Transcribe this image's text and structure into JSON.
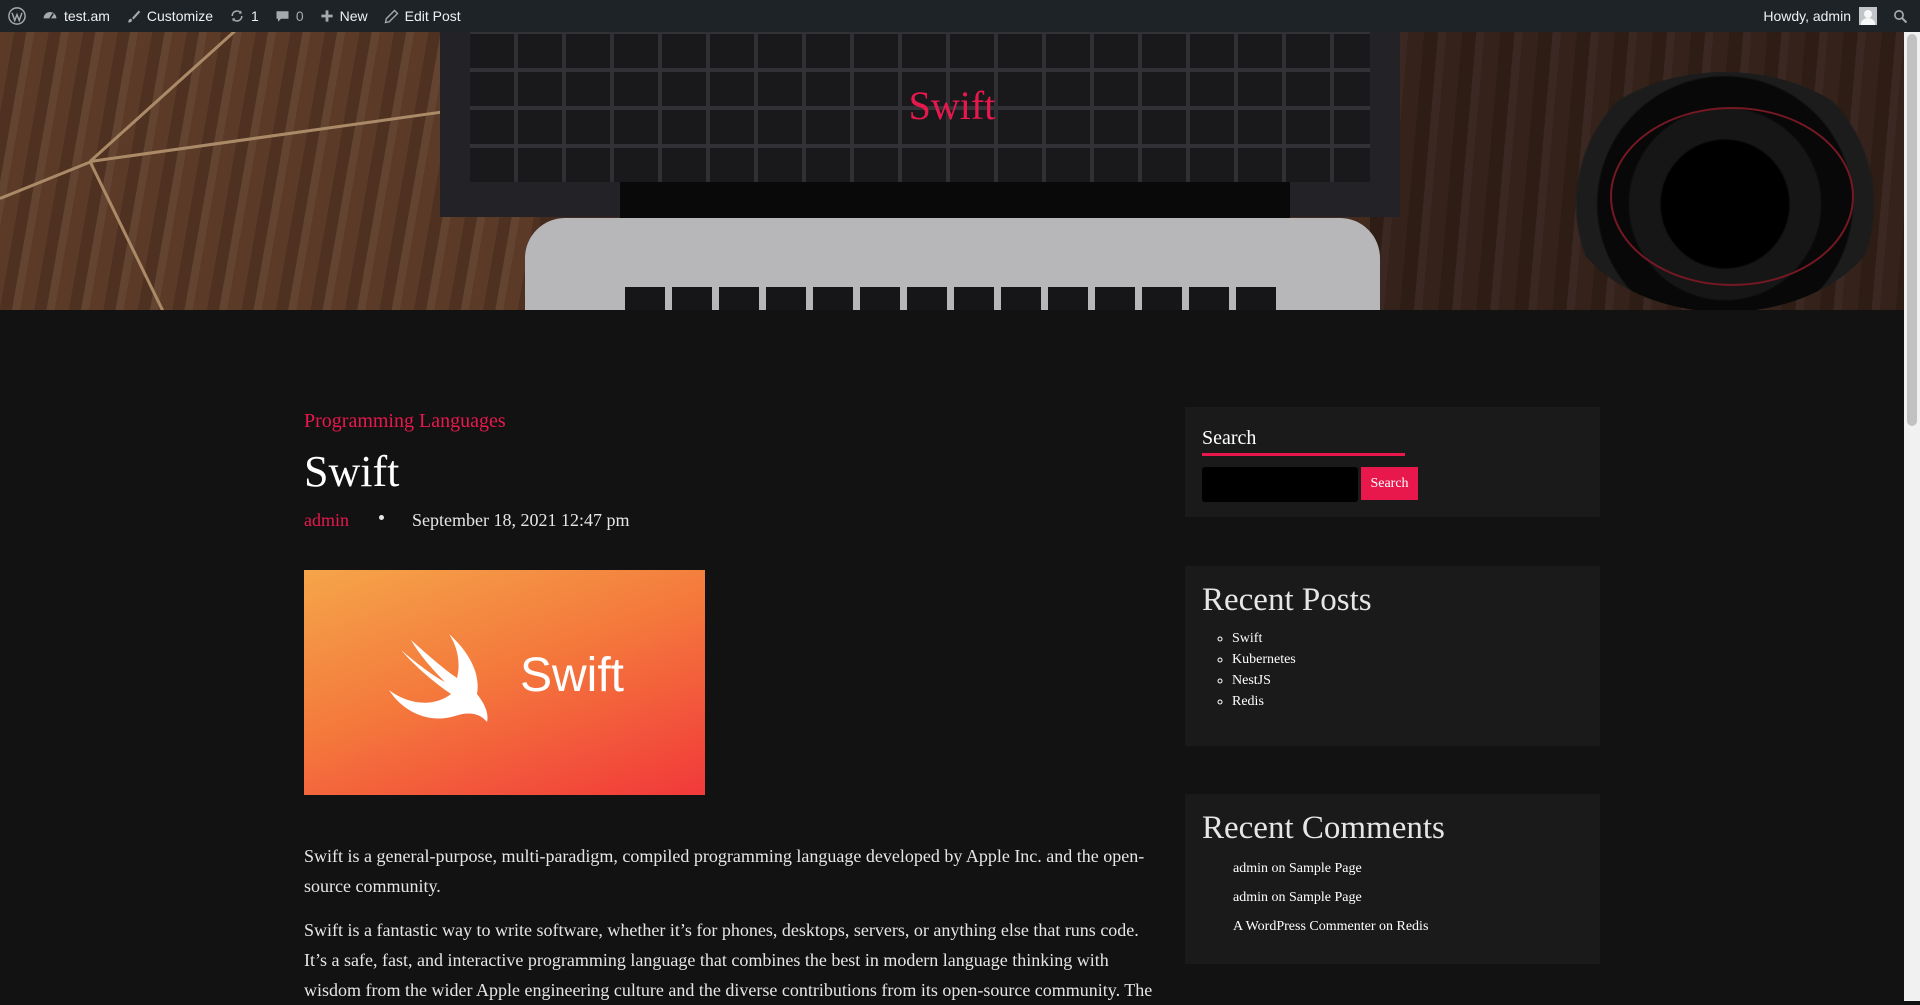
{
  "admin_bar": {
    "site_name": "test.am",
    "customize": "Customize",
    "updates_count": "1",
    "comments_count": "0",
    "new": "New",
    "edit_post": "Edit Post",
    "greeting": "Howdy, admin"
  },
  "header": {
    "site_title": "Swift"
  },
  "post": {
    "category": "Programming Languages",
    "title": "Swift",
    "author": "admin",
    "date": "September 18, 2021 12:47 pm",
    "featured_image_text": "Swift",
    "paragraphs": [
      "Swift is a general-purpose, multi-paradigm, compiled programming language developed by Apple Inc. and the open-source community.",
      "Swift is a fantastic way to write software, whether it’s for phones, desktops, servers, or anything else that runs code. It’s a safe, fast, and interactive programming language that combines the best in modern language thinking with wisdom from the wider Apple engineering culture and the diverse contributions from its open-source community. The"
    ]
  },
  "sidebar": {
    "search": {
      "title": "Search",
      "button": "Search",
      "value": ""
    },
    "recent_posts": {
      "title": "Recent Posts",
      "items": [
        "Swift",
        "Kubernetes",
        "NestJS",
        "Redis"
      ]
    },
    "recent_comments": {
      "title": "Recent Comments",
      "items": [
        {
          "author": "admin",
          "on": "on",
          "post": "Sample Page"
        },
        {
          "author": "admin",
          "on": "on",
          "post": "Sample Page"
        },
        {
          "author": "A WordPress Commenter",
          "on": "on",
          "post": "Redis"
        }
      ]
    }
  },
  "colors": {
    "accent": "#e8184d",
    "background": "#121212",
    "widget_bg": "#1a1a1a",
    "admin_bar": "#1d2327"
  }
}
